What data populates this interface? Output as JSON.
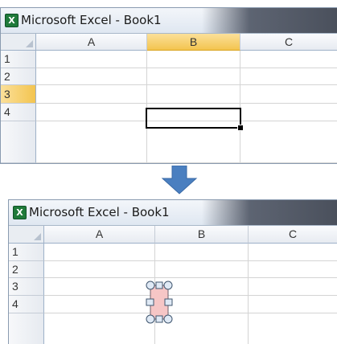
{
  "window_top": {
    "title": "Microsoft Excel - Book1",
    "app_icon_letter": "X",
    "columns": [
      "A",
      "B",
      "C"
    ],
    "rows": [
      "1",
      "2",
      "3",
      "4"
    ],
    "selected_column": "B",
    "selected_row": "3",
    "active_cell": "B3"
  },
  "window_bottom": {
    "title": "Microsoft Excel - Book1",
    "app_icon_letter": "X",
    "columns": [
      "A",
      "B",
      "C"
    ],
    "rows": [
      "1",
      "2",
      "3",
      "4"
    ],
    "shape": "rounded-rectangle-selected"
  },
  "arrow": {
    "direction": "down",
    "color": "#4a7fc0"
  },
  "colors": {
    "header_selected": "#f3c44f",
    "shape_fill": "#f6c6c6",
    "app_icon": "#1f7a3a"
  }
}
